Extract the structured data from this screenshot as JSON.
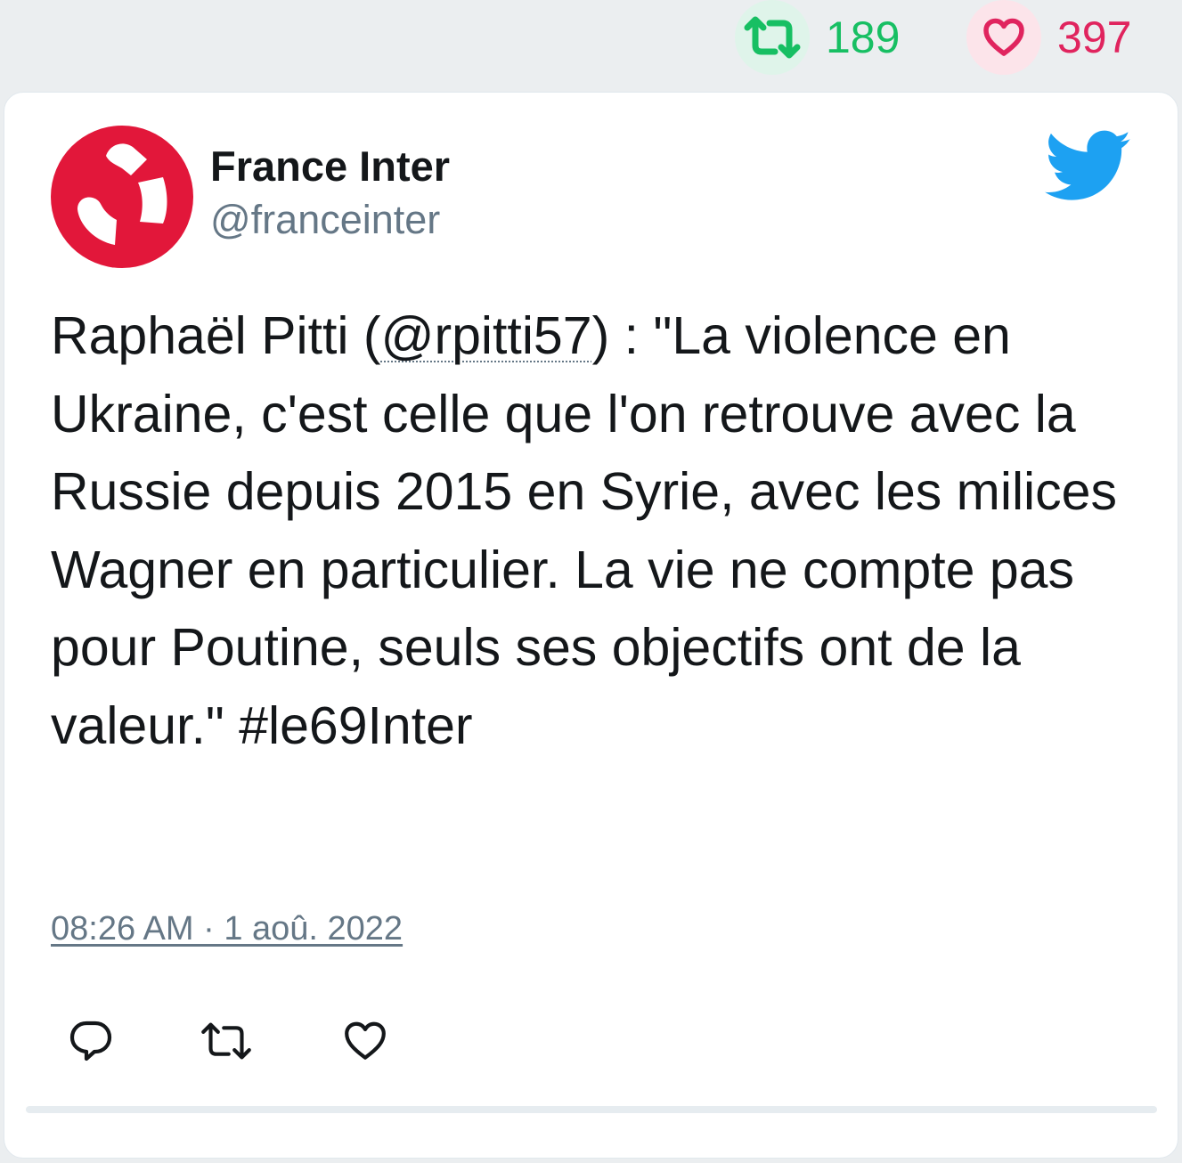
{
  "stats": {
    "retweets": "189",
    "likes": "397"
  },
  "author": {
    "name": "France Inter",
    "handle": "@franceinter"
  },
  "tweet": {
    "text_before": "Raphaël Pitti (",
    "mention": "@rpitti57",
    "text_after": ") : \"La violence en Ukraine, c'est celle que l'on retrouve avec la Russie depuis 2015 en Syrie, avec les milices Wagner en particulier. La vie ne compte pas pour Poutine, seuls ses objectifs ont de la valeur.\" #le69Inter",
    "timestamp": "08:26 AM · 1 aoû. 2022"
  },
  "icons": {
    "retweet_stat": "retweet-icon",
    "like_stat": "heart-icon",
    "brand": "twitter-bird-icon",
    "reply": "reply-icon",
    "retweet": "retweet-icon",
    "like": "heart-icon"
  },
  "colors": {
    "retweet_green": "#17bf63",
    "like_red": "#e0245e",
    "twitter_blue": "#1da1f2",
    "france_inter_red": "#e2173a",
    "secondary_text": "#657786"
  }
}
